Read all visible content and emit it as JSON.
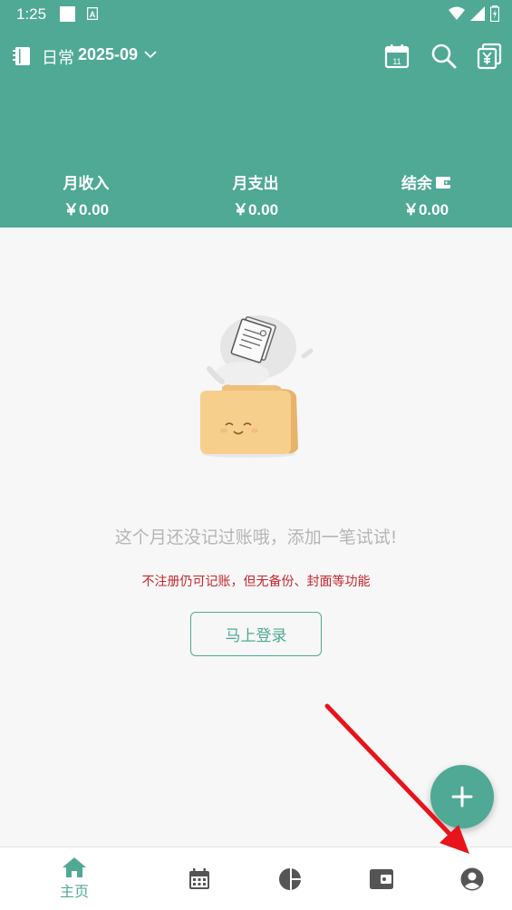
{
  "status_bar": {
    "time": "1:25"
  },
  "topbar": {
    "book_name": "日常",
    "month": "2025-09",
    "icons": [
      "notebook-icon",
      "calendar-icon",
      "search-icon",
      "currency-copy-icon"
    ],
    "calendar_day": "11"
  },
  "summary": {
    "income_label": "月收入",
    "income_value": "￥0.00",
    "expense_label": "月支出",
    "expense_value": "￥0.00",
    "balance_label": "结余",
    "balance_value": "￥0.00"
  },
  "empty_state": {
    "message": "这个月还没记过账哦，添加一笔试试!",
    "warning": "不注册仍可记账，但无备份、封面等功能",
    "login_button": "马上登录"
  },
  "bottom_nav": {
    "items": [
      {
        "icon": "home-icon",
        "label": "主页",
        "active": true
      },
      {
        "icon": "calendar-icon",
        "label": ""
      },
      {
        "icon": "pie-chart-icon",
        "label": ""
      },
      {
        "icon": "wallet-icon",
        "label": ""
      },
      {
        "icon": "account-icon",
        "label": ""
      }
    ]
  },
  "colors": {
    "primary": "#4fa994",
    "warning": "#c6262e",
    "background": "#f7f7f7",
    "annotation_arrow": "#e8141b"
  }
}
